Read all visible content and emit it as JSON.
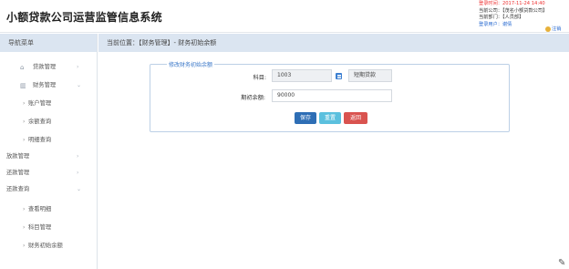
{
  "header": {
    "app_title": "小额贷款公司运营监管信息系统",
    "login_time": "登录时间：2017-11-24 14:40",
    "company": "当前公司：【茂名小额贷款公司】",
    "department": "当前部门：【人员部】",
    "user_prefix": "登录用户：",
    "user_name": "谢倩",
    "logout": "注销"
  },
  "sidebar": {
    "title": "导航菜单",
    "items": [
      {
        "label": "贷款管理",
        "icon": "home-icon"
      },
      {
        "label": "财务管理",
        "icon": "bar-chart-icon"
      },
      {
        "label": "账户管理"
      },
      {
        "label": "余额查询"
      },
      {
        "label": "明细查询"
      },
      {
        "label": "放款管理"
      },
      {
        "label": "还款管理"
      },
      {
        "label": "还款查询"
      },
      {
        "label": "查看明细"
      },
      {
        "label": "科目管理"
      },
      {
        "label": "财务初始余额"
      }
    ]
  },
  "breadcrumb": "当前位置：【财务管理】- 财务初始余额",
  "form": {
    "legend": "修改财务初始余额",
    "subject_label": "科目:",
    "subject_code": "1003",
    "subject_name": "短期贷款",
    "balance_label": "期初余额:",
    "balance_value": "90000"
  },
  "buttons": {
    "save": "保存",
    "reset": "重置",
    "back": "返回"
  }
}
